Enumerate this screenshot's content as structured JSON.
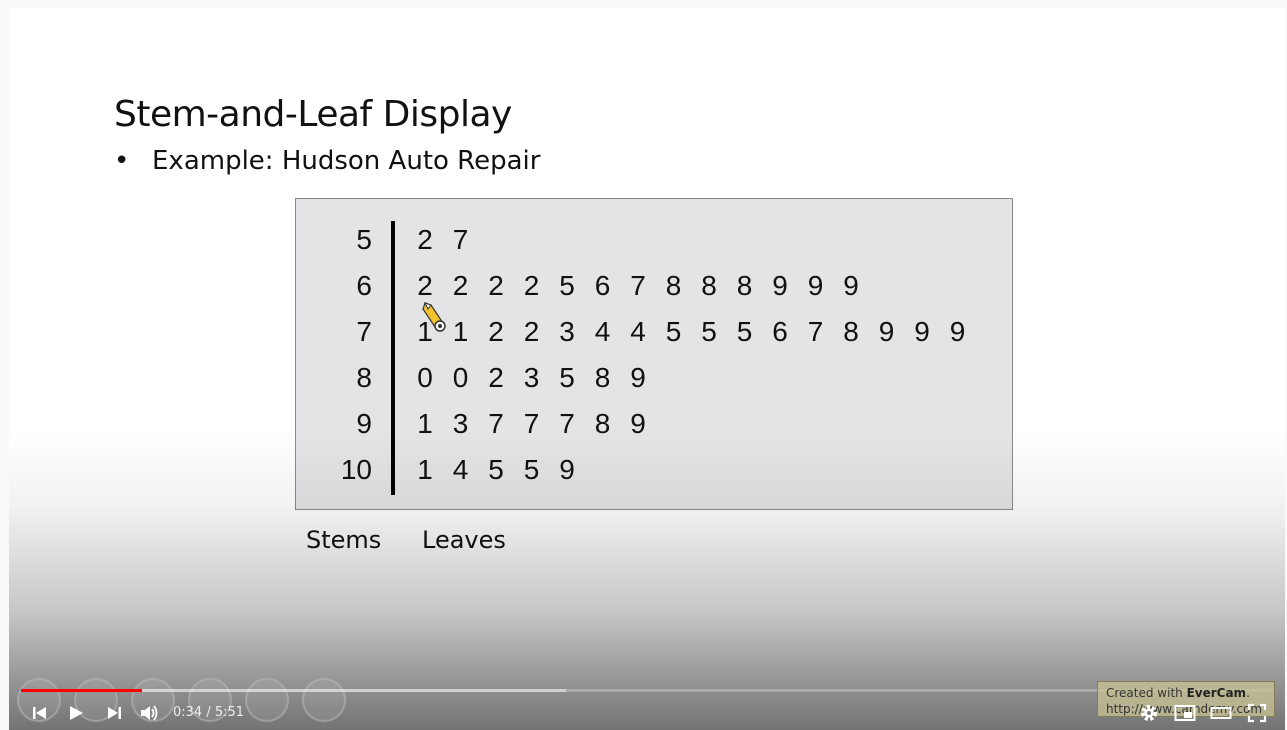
{
  "slide": {
    "title": "Stem-and-Leaf Display",
    "bullet_symbol": "•",
    "bullet_text": "Example:  Hudson Auto Repair",
    "rows": [
      {
        "stem": "5",
        "leaves": [
          "2",
          "7"
        ]
      },
      {
        "stem": "6",
        "leaves": [
          "2",
          "2",
          "2",
          "2",
          "5",
          "6",
          "7",
          "8",
          "8",
          "8",
          "9",
          "9",
          "9"
        ]
      },
      {
        "stem": "7",
        "leaves": [
          "1",
          "1",
          "2",
          "2",
          "3",
          "4",
          "4",
          "5",
          "5",
          "5",
          "6",
          "7",
          "8",
          "9",
          "9",
          "9"
        ]
      },
      {
        "stem": "8",
        "leaves": [
          "0",
          "0",
          "2",
          "3",
          "5",
          "8",
          "9"
        ]
      },
      {
        "stem": "9",
        "leaves": [
          "1",
          "3",
          "7",
          "7",
          "7",
          "8",
          "9"
        ]
      },
      {
        "stem": "10",
        "leaves": [
          "1",
          "4",
          "5",
          "5",
          "9"
        ]
      }
    ],
    "stems_label": "Stems",
    "leaves_label": "Leaves"
  },
  "player": {
    "time_display": "0:34 / 5:51",
    "progress_played_fraction": 0.0968,
    "progress_loaded_fraction": 0.435,
    "controls": {
      "previous_icon": "skip-previous-icon",
      "play_icon": "play-icon",
      "next_icon": "skip-next-icon",
      "volume_icon": "volume-icon",
      "settings_icon": "gear-icon",
      "miniplayer_icon": "miniplayer-icon",
      "theater_icon": "theater-mode-icon",
      "fullscreen_icon": "fullscreen-icon"
    },
    "accent_color": "#ff0000"
  },
  "watermark": {
    "line1_prefix": "Created with ",
    "line1_brand": "EverCam",
    "line1_suffix": ".",
    "line2": "http://www.camdemy.com"
  }
}
